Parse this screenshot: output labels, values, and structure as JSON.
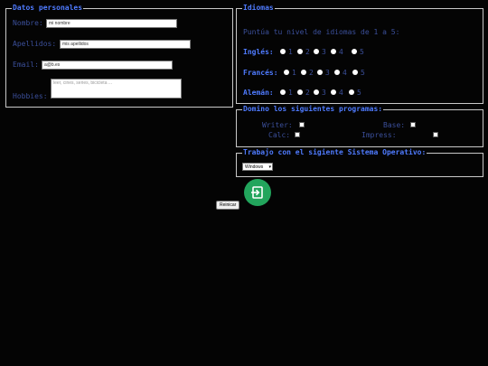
{
  "personal": {
    "legend": "Datos personales",
    "nombre_label": "Nombre:",
    "nombre_value": "mi nombre",
    "apellidos_label": "Apellidos:",
    "apellidos_value": "mis apellidos",
    "email_label": "Email:",
    "email_value": "a@b.es",
    "hobbies_label": "Hobbies:",
    "hobbies_placeholder": "leer, cines, series, bicicleta ..."
  },
  "idiomas": {
    "legend": "Idiomas",
    "intro": "Puntúa tu nivel de idiomas de 1 a 5:",
    "languages": [
      {
        "label": "Inglés:",
        "levels": [
          "1",
          "2",
          "3",
          "4",
          "5"
        ]
      },
      {
        "label": "Francés:",
        "levels": [
          "1",
          "2",
          "3",
          "4",
          "5"
        ]
      },
      {
        "label": "Alemán:",
        "levels": [
          "1",
          "2",
          "3",
          "4",
          "5"
        ]
      }
    ]
  },
  "programas": {
    "legend": "Domino los siguientes programas:",
    "items": [
      {
        "label": "Writer:"
      },
      {
        "label": "Base:"
      },
      {
        "label": "Calc:"
      },
      {
        "label": "Impress:"
      }
    ]
  },
  "so": {
    "legend": "Trabajo con el sigiente Sistema Operativo:",
    "selected": "Windows"
  },
  "actions": {
    "submit_icon": "exit-arrow-icon",
    "reset_label": "Reinicar"
  },
  "colors": {
    "background": "#040404",
    "legend": "#4f7bff",
    "label": "#3b4f9a",
    "submit": "#22a55c"
  }
}
